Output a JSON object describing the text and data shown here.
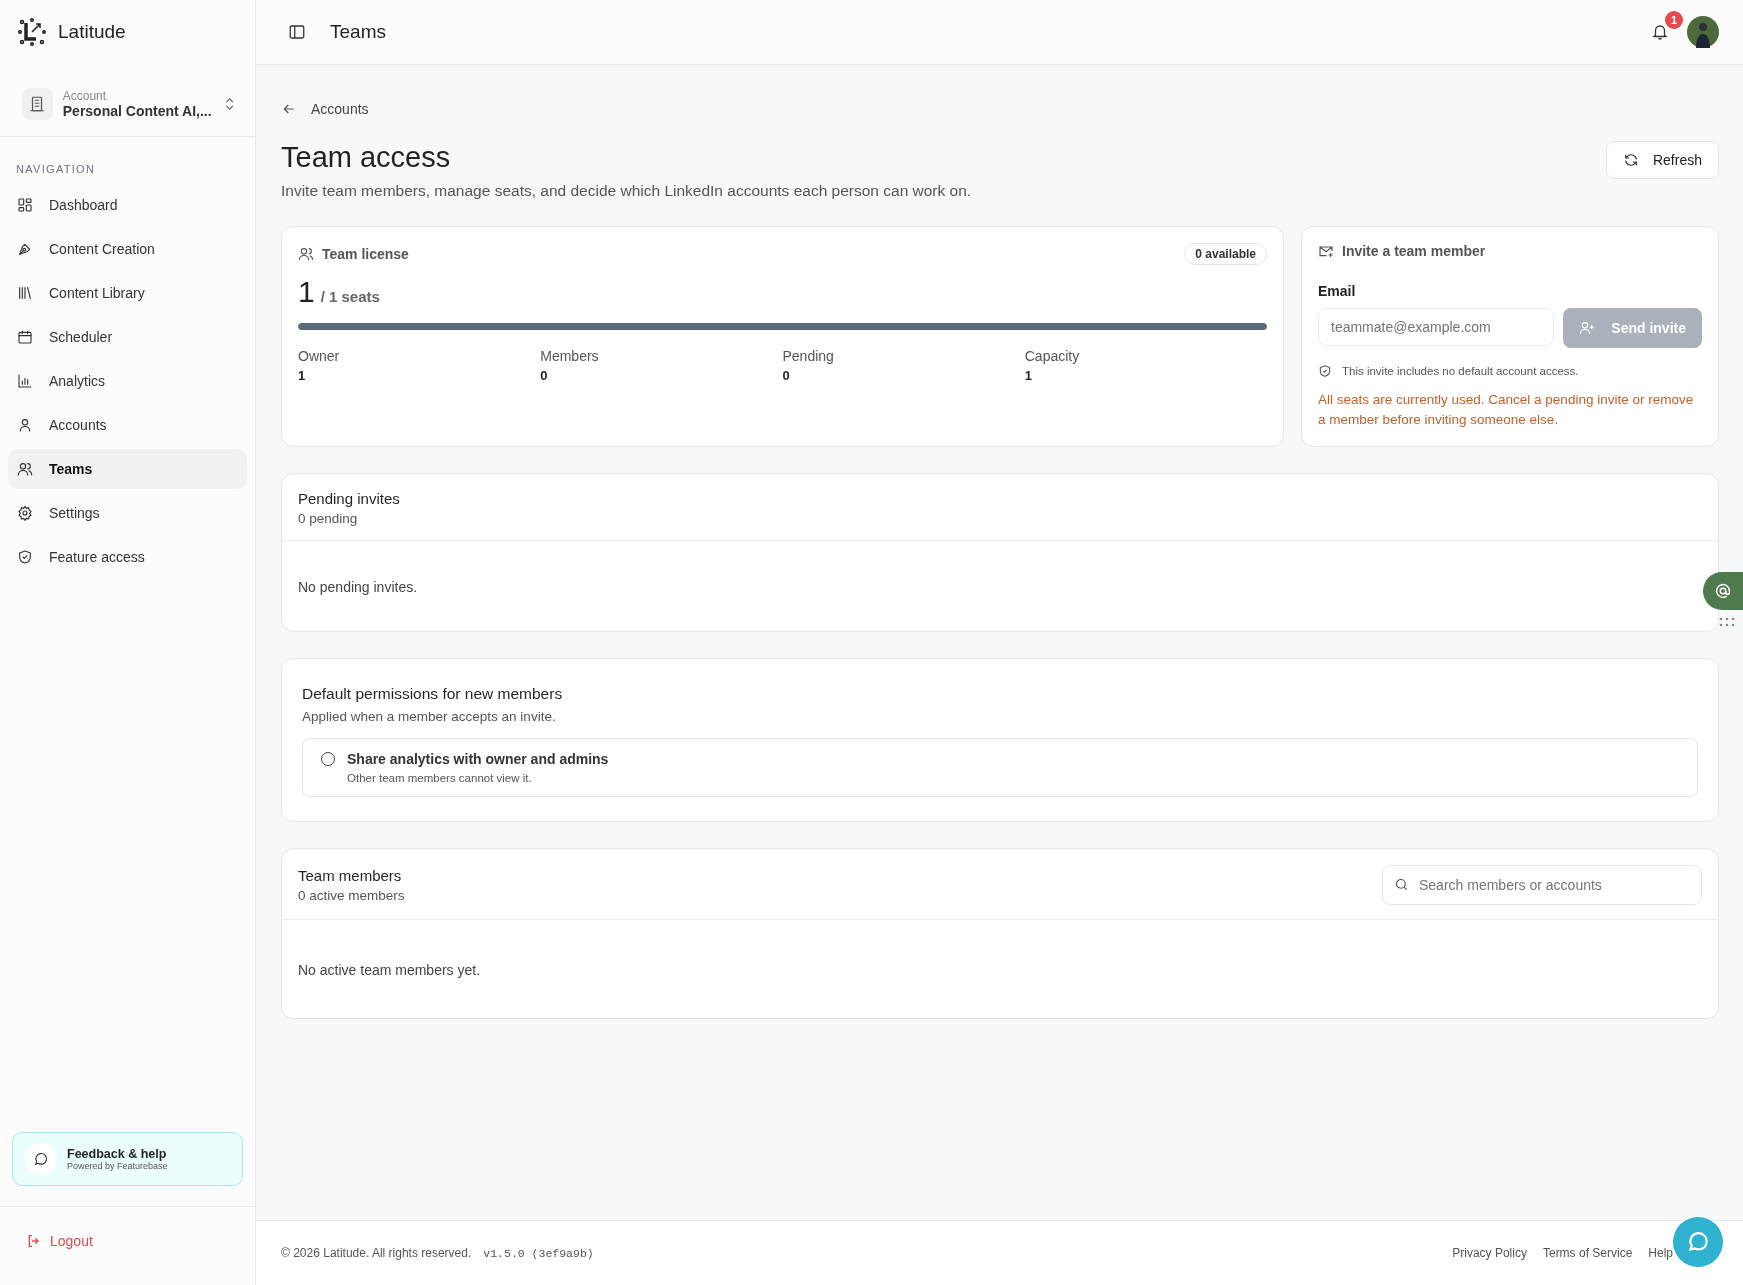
{
  "brand": {
    "name": "Latitude"
  },
  "account": {
    "label": "Account",
    "name": "Personal Content AI,..."
  },
  "sidebar": {
    "section": "NAVIGATION",
    "items": [
      {
        "label": "Dashboard",
        "selected": false
      },
      {
        "label": "Content Creation",
        "selected": false
      },
      {
        "label": "Content Library",
        "selected": false
      },
      {
        "label": "Scheduler",
        "selected": false
      },
      {
        "label": "Analytics",
        "selected": false
      },
      {
        "label": "Accounts",
        "selected": false
      },
      {
        "label": "Teams",
        "selected": true
      },
      {
        "label": "Settings",
        "selected": false
      },
      {
        "label": "Feature access",
        "selected": false
      }
    ]
  },
  "feedback": {
    "title": "Feedback & help",
    "subtitle": "Powered by Featurebase"
  },
  "logout": "Logout",
  "topbar": {
    "title": "Teams",
    "notifications": "1"
  },
  "breadcrumb": "Accounts",
  "page": {
    "title": "Team access",
    "subtitle": "Invite team members, manage seats, and decide which LinkedIn accounts each person can work on.",
    "refresh": "Refresh"
  },
  "license": {
    "title": "Team license",
    "badge": "0 available",
    "used": "1",
    "total": "/ 1 seats",
    "level": 1,
    "stats": [
      {
        "label": "Owner",
        "value": "1"
      },
      {
        "label": "Members",
        "value": "0"
      },
      {
        "label": "Pending",
        "value": "0"
      },
      {
        "label": "Capacity",
        "value": "1"
      }
    ]
  },
  "invite": {
    "title": "Invite a team member",
    "email_label": "Email",
    "placeholder": "teammate@example.com",
    "button": "Send invite",
    "button_disabled": true,
    "note": "This invite includes no default account access.",
    "warning": "All seats are currently used. Cancel a pending invite or remove a member before inviting someone else."
  },
  "pending": {
    "title": "Pending invites",
    "count": "0 pending",
    "empty": "No pending invites."
  },
  "defaults": {
    "title": "Default permissions for new members",
    "subtitle": "Applied when a member accepts an invite.",
    "options": [
      {
        "label": "Share analytics with owner and admins",
        "hint": "Other team members cannot view it.",
        "checked": false
      }
    ]
  },
  "members": {
    "title": "Team members",
    "count": "0 active members",
    "search_placeholder": "Search members or accounts",
    "empty": "No active team members yet."
  },
  "footer": {
    "copyright": "© 2026 Latitude. All rights reserved.",
    "version": "v1.5.0 (3ef9a9b)",
    "links": [
      "Privacy Policy",
      "Terms of Service",
      "Help"
    ]
  }
}
